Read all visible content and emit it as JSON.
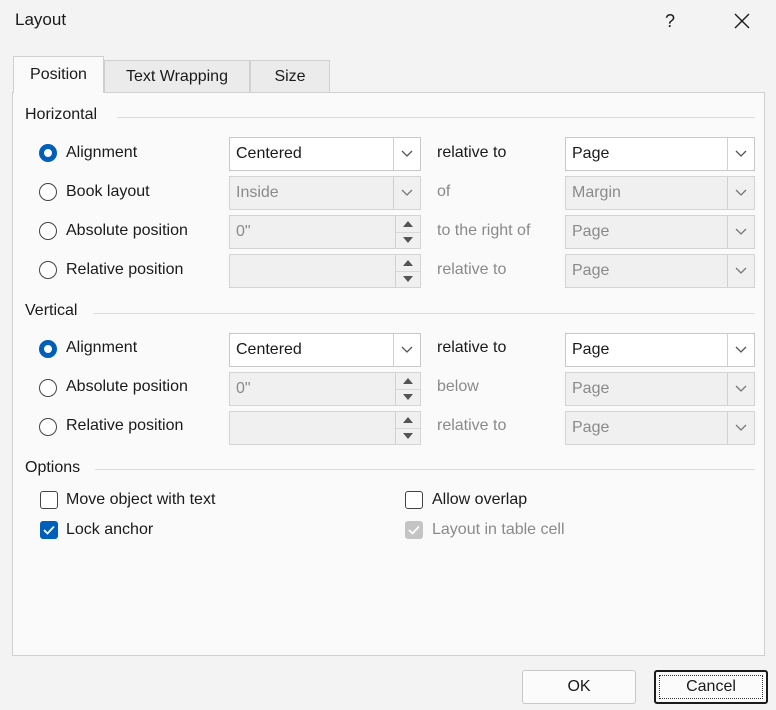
{
  "dialog": {
    "title": "Layout",
    "help_glyph": "?",
    "close_icon": "close-icon"
  },
  "tabs": [
    {
      "label": "Position",
      "active": true
    },
    {
      "label": "Text Wrapping",
      "active": false
    },
    {
      "label": "Size",
      "active": false
    }
  ],
  "horizontal": {
    "heading": "Horizontal",
    "rows": [
      {
        "option": "Alignment",
        "selected": true,
        "control": "combo",
        "value": "Centered",
        "enabled": true,
        "relation": "relative to",
        "target": "Page"
      },
      {
        "option": "Book layout",
        "selected": false,
        "control": "combo",
        "value": "Inside",
        "enabled": false,
        "relation": "of",
        "target": "Margin"
      },
      {
        "option": "Absolute position",
        "selected": false,
        "control": "spin",
        "value": "0\"",
        "enabled": false,
        "relation": "to the right of",
        "target": "Page"
      },
      {
        "option": "Relative position",
        "selected": false,
        "control": "spin",
        "value": "",
        "enabled": false,
        "relation": "relative to",
        "target": "Page"
      }
    ]
  },
  "vertical": {
    "heading": "Vertical",
    "rows": [
      {
        "option": "Alignment",
        "selected": true,
        "control": "combo",
        "value": "Centered",
        "enabled": true,
        "relation": "relative to",
        "target": "Page"
      },
      {
        "option": "Absolute position",
        "selected": false,
        "control": "spin",
        "value": "0\"",
        "enabled": false,
        "relation": "below",
        "target": "Page"
      },
      {
        "option": "Relative position",
        "selected": false,
        "control": "spin",
        "value": "",
        "enabled": false,
        "relation": "relative to",
        "target": "Page"
      }
    ]
  },
  "options": {
    "heading": "Options",
    "move_object": {
      "label": "Move object with text",
      "checked": false,
      "enabled": true
    },
    "lock_anchor": {
      "label": "Lock anchor",
      "checked": true,
      "enabled": true
    },
    "allow_overlap": {
      "label": "Allow overlap",
      "checked": false,
      "enabled": true
    },
    "layout_in_cell": {
      "label": "Layout in table cell",
      "checked": true,
      "enabled": false
    }
  },
  "buttons": {
    "ok": "OK",
    "cancel": "Cancel"
  },
  "colors": {
    "accent": "#005fb8",
    "disabled_text": "#8a8a8a"
  }
}
